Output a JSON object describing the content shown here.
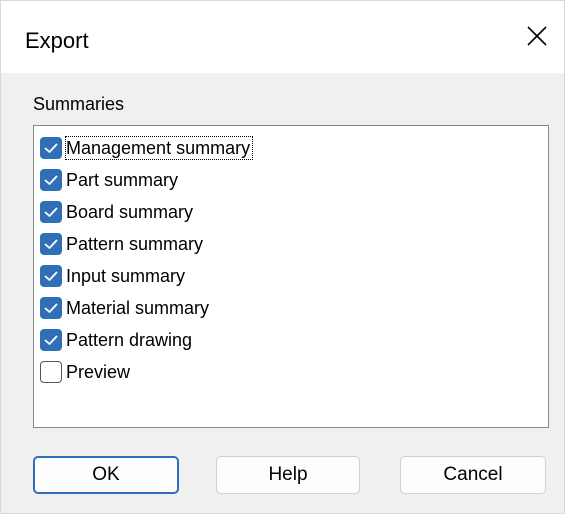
{
  "window": {
    "title": "Export",
    "close_icon": "close-icon"
  },
  "summaries": {
    "label": "Summaries",
    "items": [
      {
        "label": "Management summary",
        "checked": true
      },
      {
        "label": "Part summary",
        "checked": true
      },
      {
        "label": "Board summary",
        "checked": true
      },
      {
        "label": "Pattern summary",
        "checked": true
      },
      {
        "label": "Input summary",
        "checked": true
      },
      {
        "label": "Material summary",
        "checked": true
      },
      {
        "label": "Pattern drawing",
        "checked": true
      },
      {
        "label": "Preview",
        "checked": false
      }
    ]
  },
  "buttons": {
    "ok": "OK",
    "help": "Help",
    "cancel": "Cancel"
  },
  "colors": {
    "accent": "#2f6fb8",
    "dialog_bg": "#f0f0f0"
  }
}
